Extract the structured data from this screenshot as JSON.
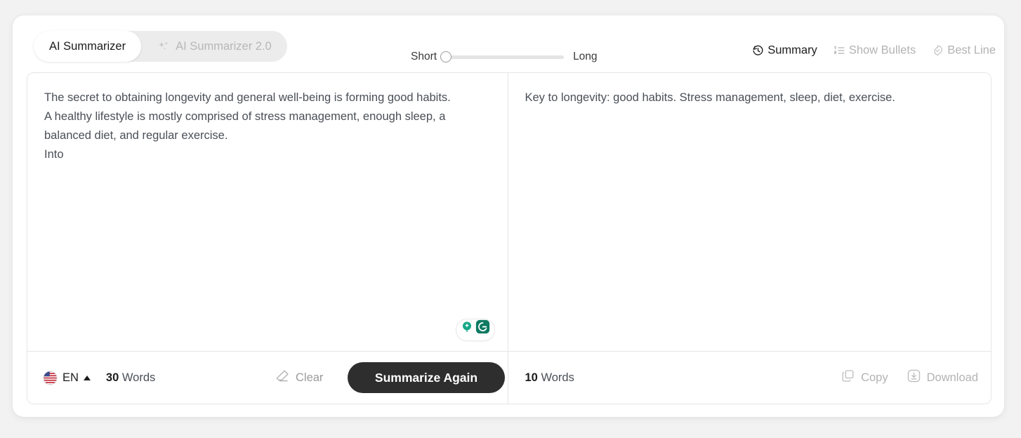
{
  "tabs": [
    {
      "label": "AI Summarizer",
      "active": true,
      "icon": ""
    },
    {
      "label": "AI Summarizer 2.0",
      "active": false,
      "icon": "sparkles-icon"
    }
  ],
  "slider": {
    "min_label": "Short",
    "max_label": "Long",
    "value_percent": 0
  },
  "toolbar_actions": [
    {
      "label": "Summary",
      "icon": "history-arrow-icon",
      "active": true
    },
    {
      "label": "Show Bullets",
      "icon": "numbered-list-icon",
      "active": false
    },
    {
      "label": "Best Line",
      "icon": "check-badge-icon",
      "active": false
    }
  ],
  "input_panel": {
    "lines": [
      "The secret to obtaining longevity and general well-being is forming good habits.",
      "A healthy lifestyle is mostly comprised of stress management, enough sleep, a balanced diet, and regular exercise.",
      "Into"
    ],
    "assistant_badge": {
      "icons": [
        "lightbulb-icon",
        "grammarly-g-icon"
      ],
      "color_primary": "#15a886",
      "color_secondary": "#0e7a62"
    },
    "footer": {
      "language_code": "EN",
      "language_flag": "us-flag-icon",
      "word_count_number": "30",
      "word_count_label": "Words",
      "clear_label": "Clear",
      "clear_icon": "eraser-icon",
      "primary_button_label": "Summarize Again"
    }
  },
  "output_panel": {
    "text": "Key to longevity: good habits. Stress management, sleep, diet, exercise.",
    "footer": {
      "word_count_number": "10",
      "word_count_label": "Words",
      "actions": [
        {
          "label": "Copy",
          "icon": "copy-icon"
        },
        {
          "label": "Download",
          "icon": "download-icon"
        }
      ]
    }
  },
  "colors": {
    "page_background": "#f2f2f2",
    "card_background": "#ffffff",
    "primary_button": "#2e2e2e",
    "muted_text": "#b3b3b3",
    "body_text": "#4a4f57",
    "border": "#e6e6e6"
  }
}
